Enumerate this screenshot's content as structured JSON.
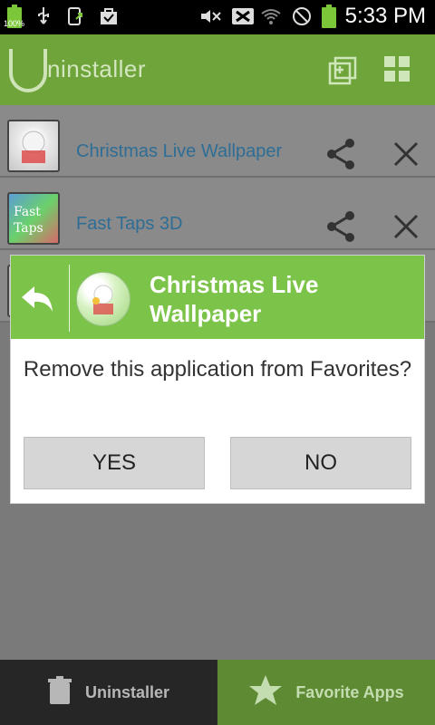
{
  "status_bar": {
    "time": "5:33 PM",
    "battery_left_label": "100%",
    "icons_left": [
      "battery-icon",
      "usb-icon",
      "upload-icon",
      "bag-icon"
    ],
    "icons_right": [
      "mute-icon",
      "no-sim-icon",
      "wifi-icon",
      "blocked-icon",
      "battery-icon"
    ],
    "colors": {
      "battery": "#7cc63a"
    }
  },
  "appbar": {
    "title": "ninstaller",
    "actions": [
      "add-to-favorites-icon",
      "grid-view-icon"
    ],
    "color": "#6ea43a"
  },
  "list": {
    "items": [
      {
        "name": "Christmas Live Wallpaper",
        "share_icon": "share-icon",
        "remove_icon": "close-icon"
      },
      {
        "name": "Fast Taps 3D",
        "share_icon": "share-icon",
        "remove_icon": "close-icon"
      }
    ]
  },
  "dialog": {
    "back_icon": "back-arrow-icon",
    "app_icon": "christmas-wallpaper-icon",
    "title": "Christmas Live Wallpaper",
    "message": "Remove this application from Favorites?",
    "yes_label": "YES",
    "no_label": "NO",
    "header_color": "#7cc349"
  },
  "bottom_tabs": [
    {
      "label": "Uninstaller",
      "icon": "trash-icon"
    },
    {
      "label": "Favorite Apps",
      "icon": "star-icon"
    }
  ]
}
